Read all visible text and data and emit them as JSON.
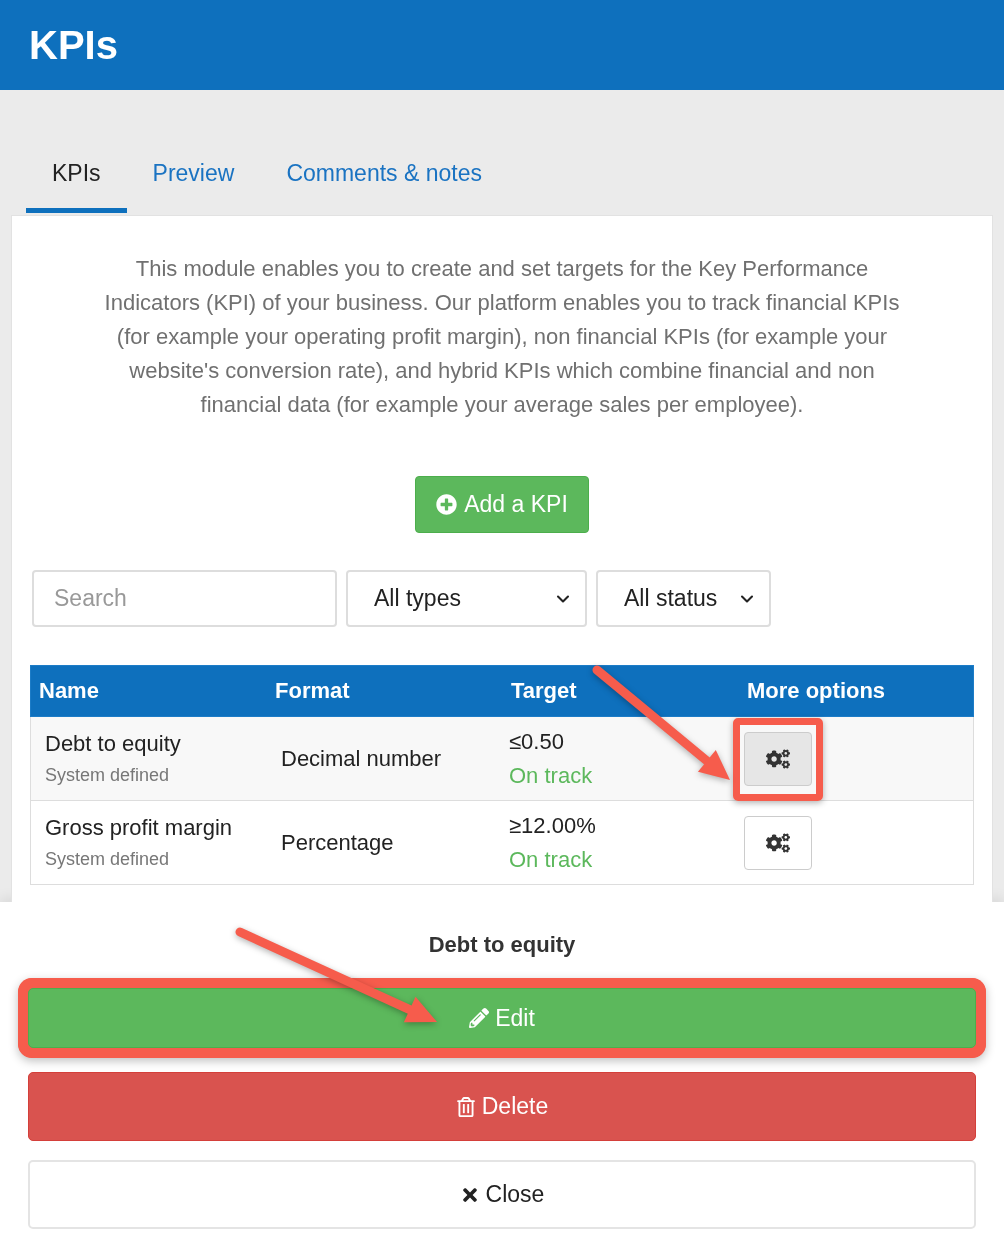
{
  "header": {
    "title": "KPIs"
  },
  "tabs": [
    {
      "label": "KPIs",
      "selected": true
    },
    {
      "label": "Preview",
      "selected": false
    },
    {
      "label": "Comments & notes",
      "selected": false
    }
  ],
  "description": "This module enables you to create and set targets for the Key Performance Indicators (KPI) of your business. Our platform enables you to track financial KPIs (for example your operating profit margin), non financial KPIs (for example your website's conversion rate), and hybrid KPIs which combine financial and non financial data (for example your average sales per employee).",
  "add_button": {
    "label": "Add a KPI"
  },
  "filters": {
    "search": {
      "placeholder": "Search"
    },
    "type_select": {
      "value": "All types"
    },
    "status_select": {
      "value": "All status"
    }
  },
  "table": {
    "columns": [
      "Name",
      "Format",
      "Target",
      "More options"
    ],
    "rows": [
      {
        "name": "Debt to equity",
        "source": "System defined",
        "format": "Decimal number",
        "target": "≤0.50",
        "status": "On track",
        "highlighted": true
      },
      {
        "name": "Gross profit margin",
        "source": "System defined",
        "format": "Percentage",
        "target": "≥12.00%",
        "status": "On track",
        "highlighted": false
      }
    ]
  },
  "sheet": {
    "title": "Debt to equity",
    "actions": [
      {
        "kind": "edit",
        "label": "Edit",
        "highlighted": true
      },
      {
        "kind": "delete",
        "label": "Delete",
        "highlighted": false
      },
      {
        "kind": "close",
        "label": "Close",
        "highlighted": false
      }
    ]
  }
}
